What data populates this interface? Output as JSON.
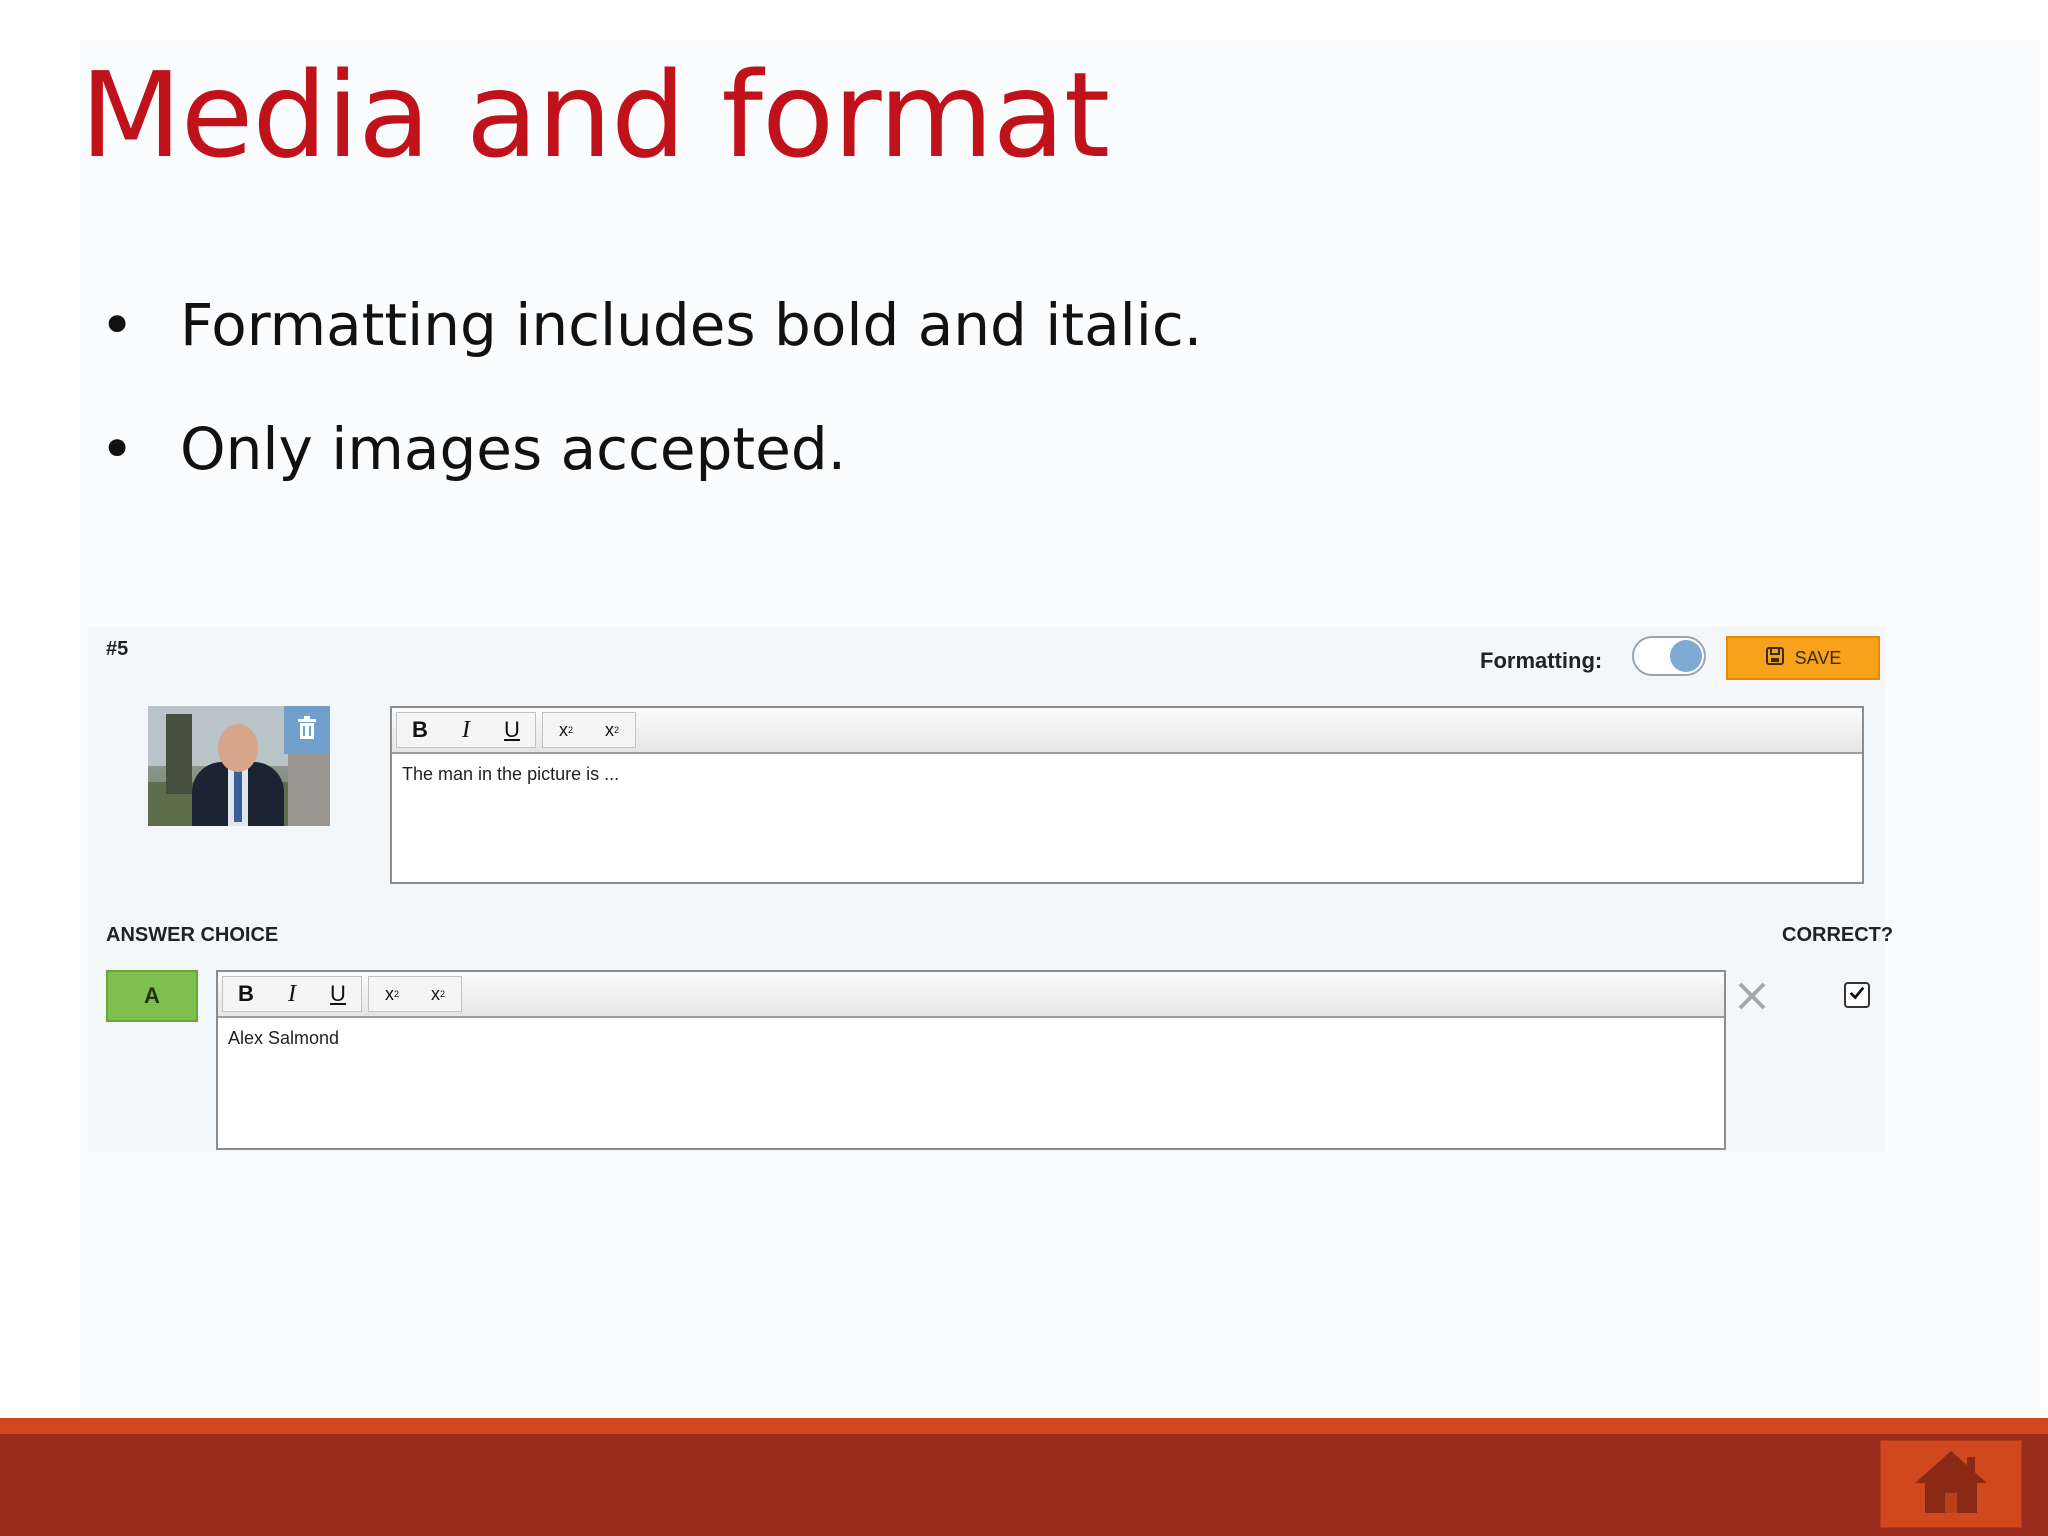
{
  "slide": {
    "title": "Media and format",
    "bullets": [
      {
        "marker": "•",
        "text": "Formatting includes bold and italic."
      },
      {
        "marker": "•",
        "text": "Only images accepted."
      }
    ]
  },
  "editor": {
    "question_number": "#5",
    "formatting_label": "Formatting:",
    "formatting_enabled": true,
    "save_label": "SAVE",
    "question_text": "The man in the picture is ...",
    "toolbar": {
      "bold": "B",
      "italic": "I",
      "underline": "U",
      "subscript": "x",
      "superscript": "x"
    },
    "answer_header": "ANSWER CHOICE",
    "correct_header": "CORRECT?",
    "choices": [
      {
        "letter": "A",
        "text": "Alex Salmond",
        "correct": true
      }
    ]
  },
  "colors": {
    "title": "#c0121a",
    "save_button": "#f6a21a",
    "choice_badge": "#7fbf4d",
    "footer": "#992c1d",
    "footer_line": "#d24722",
    "toggle_knob": "#7ea9d2"
  },
  "icons": [
    "save-icon",
    "trash-icon",
    "close-icon",
    "checkbox-checked-icon",
    "home-icon"
  ]
}
